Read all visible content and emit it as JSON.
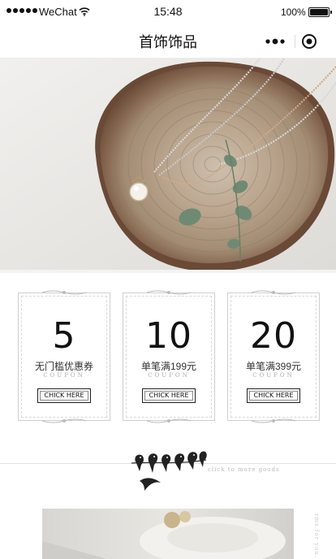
{
  "status_bar": {
    "carrier": "WeChat",
    "time": "15:48",
    "battery": "100%"
  },
  "nav": {
    "title": "首饰饰品"
  },
  "coupons": [
    {
      "value": "5",
      "desc": "无门槛优惠券",
      "sub": "COUPON",
      "button": "CHICK HERE"
    },
    {
      "value": "10",
      "desc": "单笔满199元",
      "sub": "COUPON",
      "button": "CHICK HERE"
    },
    {
      "value": "20",
      "desc": "单笔满399元",
      "sub": "COUPON",
      "button": "CHICK HERE"
    }
  ],
  "divider": {
    "caption": "click to more goods"
  },
  "photo": {
    "side_text": "rms for you."
  },
  "icons": {
    "signal": "signal-dots-icon",
    "wifi": "wifi-icon",
    "battery": "battery-icon",
    "more": "more-dots-icon",
    "close": "close-circle-icon",
    "birds": "birds-on-branch-icon"
  }
}
